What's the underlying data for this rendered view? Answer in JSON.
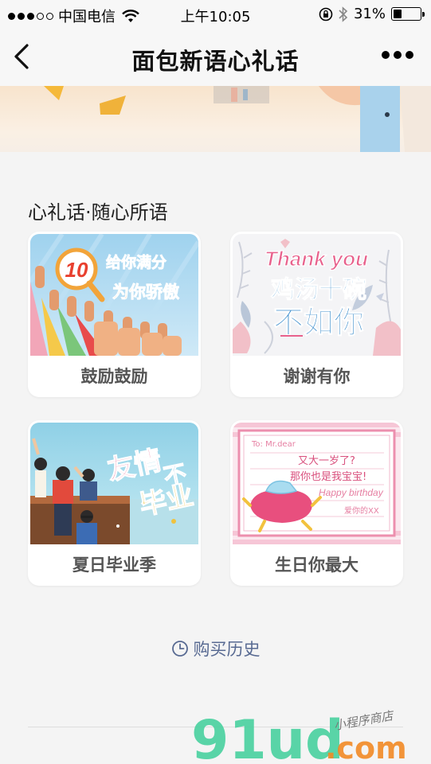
{
  "status_bar": {
    "carrier": "中国电信",
    "time": "上午10:05",
    "battery": "31%",
    "battery_level": 0.31,
    "signal_bars": 3,
    "icons": [
      "signal-icon",
      "wifi-icon",
      "orientation-lock-icon",
      "bluetooth-icon",
      "battery-icon"
    ]
  },
  "nav": {
    "title": "面包新语心礼话",
    "back_icon": "chevron-left-icon",
    "more_icon": "more-dots-icon"
  },
  "section": {
    "title": "心礼话·随心所语"
  },
  "cards": [
    {
      "label": "鼓励鼓励",
      "image_text": [
        "10",
        "给你满分",
        "为你骄傲"
      ]
    },
    {
      "label": "谢谢有你",
      "image_text": [
        "Thank you",
        "鸡汤十碗",
        "不如你"
      ]
    },
    {
      "label": "夏日毕业季",
      "image_text": [
        "友情",
        "不",
        "毕业"
      ]
    },
    {
      "label": "生日你最大",
      "image_text": [
        "又大一岁了?",
        "那你也是我宝宝!",
        "Happy birthday",
        "爱你的XX"
      ]
    }
  ],
  "history": {
    "label": "购买历史",
    "icon": "clock-icon"
  },
  "watermark": {
    "brand": "91ud",
    "domain": ".com",
    "tagline": "小程序商店"
  },
  "colors": {
    "history_text": "#586a92",
    "card_label": "#555555",
    "background": "#f4f4f4"
  }
}
